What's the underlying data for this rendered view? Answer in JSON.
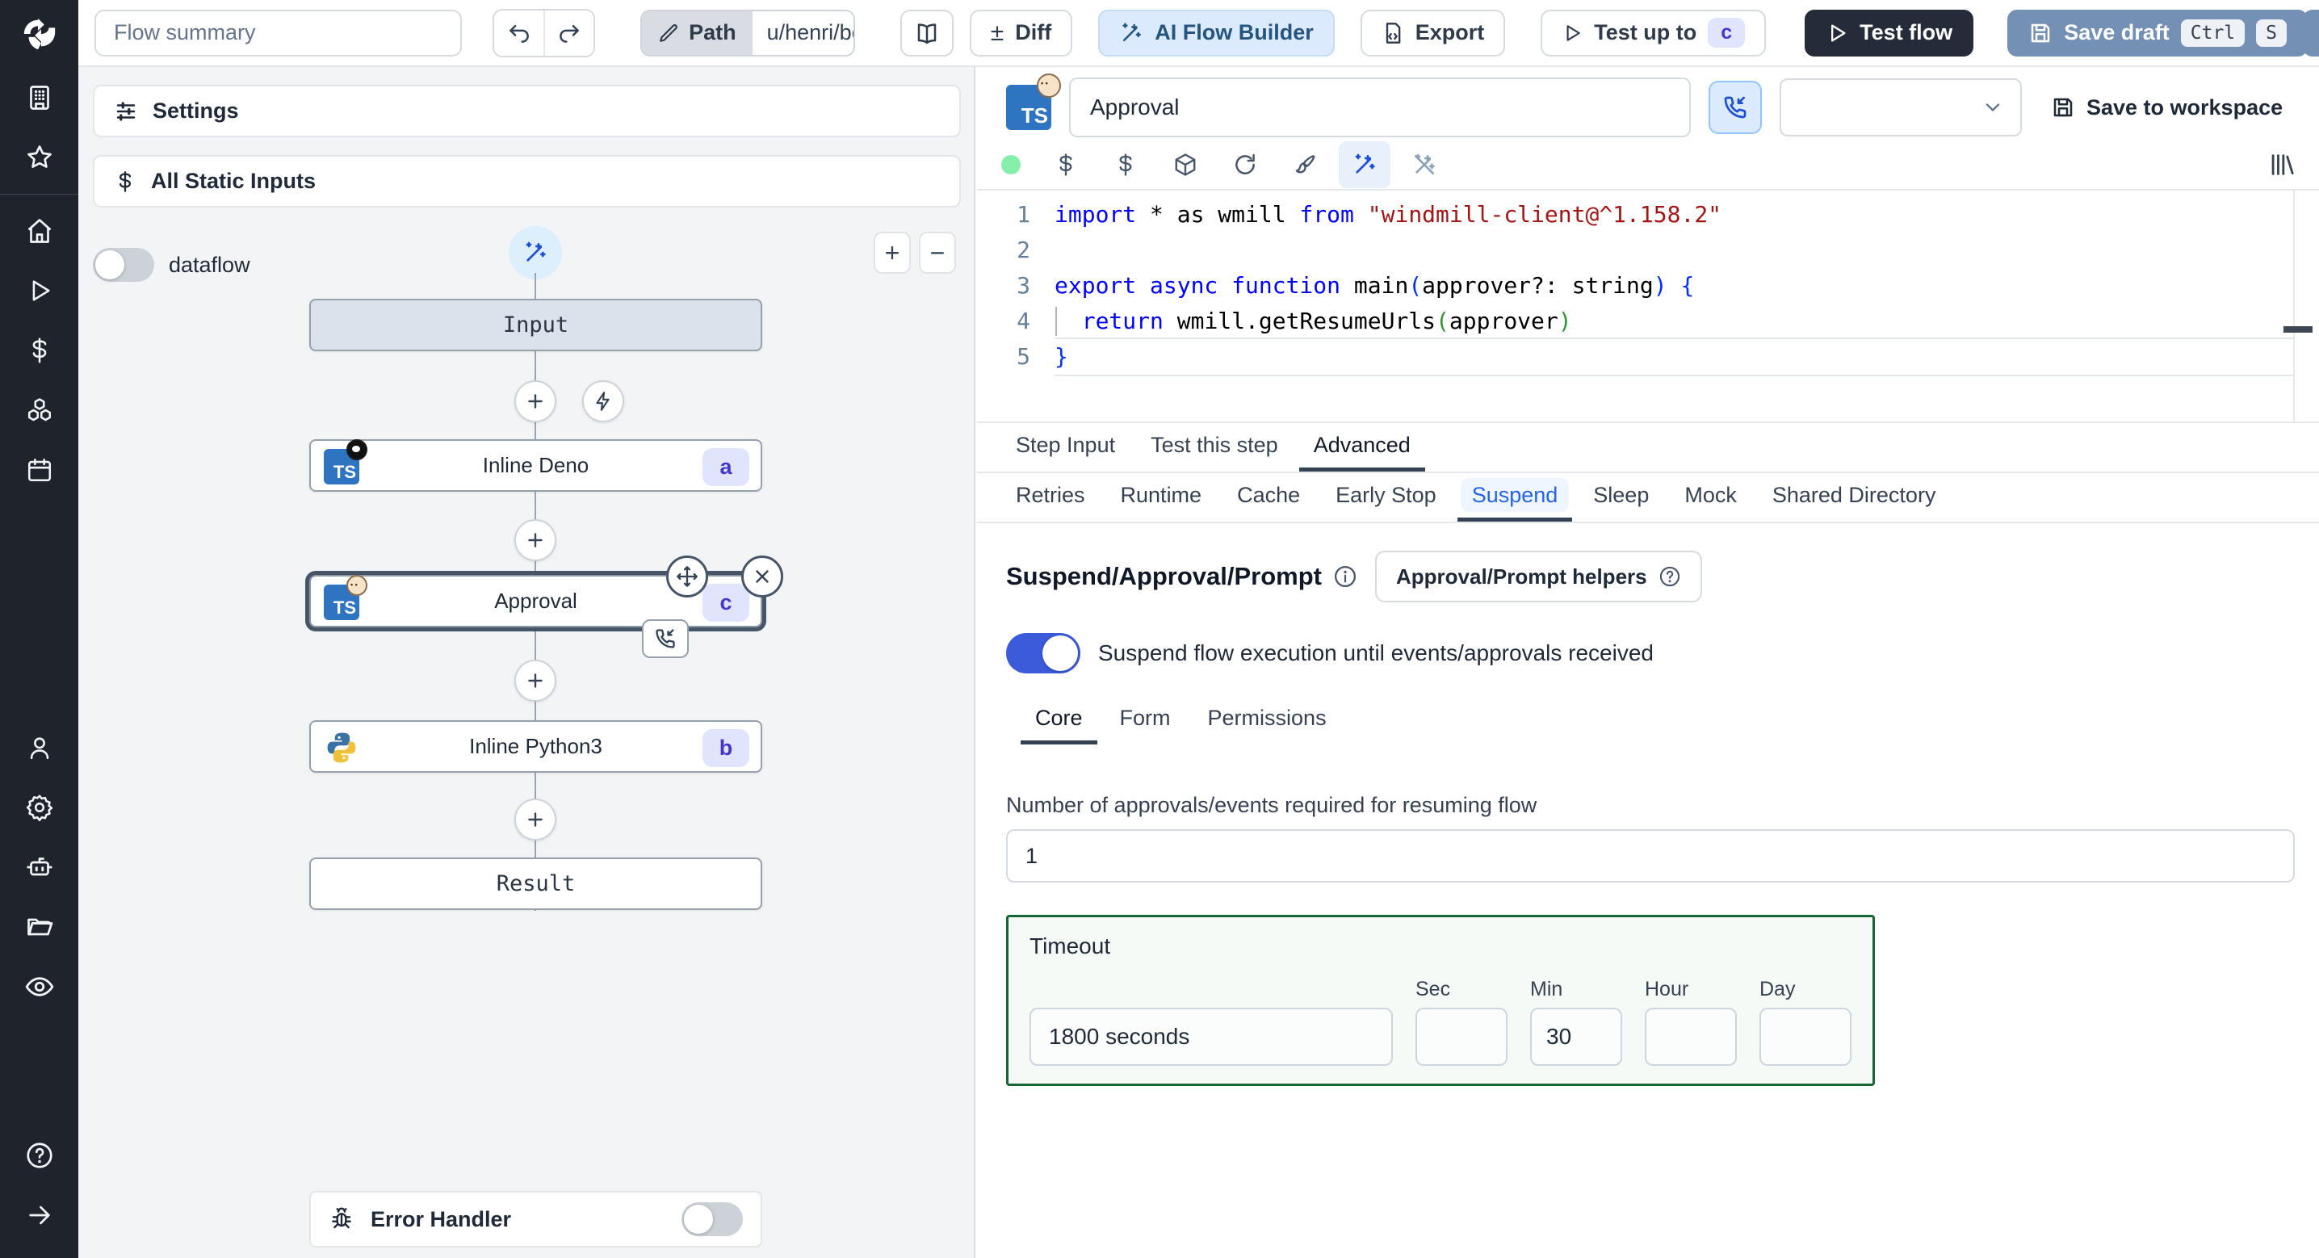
{
  "topbar": {
    "flow_summary_placeholder": "Flow summary",
    "path_label": "Path",
    "path_value": "u/henri/bes",
    "diff_label": "Diff",
    "ai_flow_builder_label": "AI Flow Builder",
    "export_label": "Export",
    "test_up_to_label": "Test up to",
    "test_up_to_badge": "c",
    "test_flow_label": "Test flow",
    "save_draft_label": "Save draft",
    "save_draft_kbd_1": "Ctrl",
    "save_draft_kbd_2": "S",
    "diff_sign": "±"
  },
  "sidebar": {
    "items": [
      "workspace",
      "favorites",
      "home",
      "runs",
      "variables",
      "resources",
      "schedules",
      "users",
      "settings",
      "workers",
      "folders",
      "audit-logs",
      "help",
      "collapse"
    ]
  },
  "left_panel": {
    "settings_label": "Settings",
    "all_static_inputs_label": "All Static Inputs",
    "dataflow_label": "dataflow",
    "zoom_in": "+",
    "zoom_out": "−",
    "error_handler_label": "Error Handler",
    "graph": {
      "input_label": "Input",
      "result_label": "Result",
      "nodes": [
        {
          "label": "Inline Deno",
          "badge": "a",
          "lang": "deno"
        },
        {
          "label": "Approval",
          "badge": "c",
          "lang": "bun"
        },
        {
          "label": "Inline Python3",
          "badge": "b",
          "lang": "python"
        }
      ]
    }
  },
  "editor": {
    "step_name_value": "Approval",
    "save_to_workspace_label": "Save to workspace",
    "status_color": "#86efac",
    "code_lines": [
      [
        [
          "kw",
          "import"
        ],
        [
          "pl",
          " * as wmill "
        ],
        [
          "kw",
          "from"
        ],
        [
          "str",
          " \"windmill-client@^1.158.2\""
        ]
      ],
      [
        [
          "pl",
          ""
        ]
      ],
      [
        [
          "kw",
          "export async function "
        ],
        [
          "pl",
          "main"
        ],
        [
          "pb",
          "("
        ],
        [
          "pl",
          "approver?: string"
        ],
        [
          "pb",
          ") {"
        ]
      ],
      [
        [
          "pl",
          "  "
        ],
        [
          "kw",
          "return"
        ],
        [
          "pl",
          " wmill.getResumeUrls"
        ],
        [
          "pg",
          "("
        ],
        [
          "pl",
          "approver"
        ],
        [
          "pg",
          ")"
        ]
      ],
      [
        [
          "pb",
          "}"
        ]
      ]
    ],
    "current_line": 5
  },
  "tabs": {
    "step": [
      "Step Input",
      "Test this step",
      "Advanced"
    ],
    "step_selected": "Advanced",
    "advanced": [
      "Retries",
      "Runtime",
      "Cache",
      "Early Stop",
      "Suspend",
      "Sleep",
      "Mock",
      "Shared Directory"
    ],
    "advanced_selected": "Suspend"
  },
  "suspend_section": {
    "heading": "Suspend/Approval/Prompt",
    "helpers_button_label": "Approval/Prompt helpers",
    "toggle_label": "Suspend flow execution until events/approvals received",
    "toggle_on_color": "#3b5bdb",
    "sub_tabs": [
      "Core",
      "Form",
      "Permissions"
    ],
    "sub_tab_selected": "Core",
    "approvals_label": "Number of approvals/events required for resuming flow",
    "approvals_value": "1",
    "timeout_label": "Timeout",
    "timeout_display_value": "1800 seconds",
    "timeout_units": [
      "Sec",
      "Min",
      "Hour",
      "Day"
    ],
    "timeout_values": [
      "",
      "30",
      "",
      ""
    ],
    "timeout_border_color": "#166534"
  }
}
